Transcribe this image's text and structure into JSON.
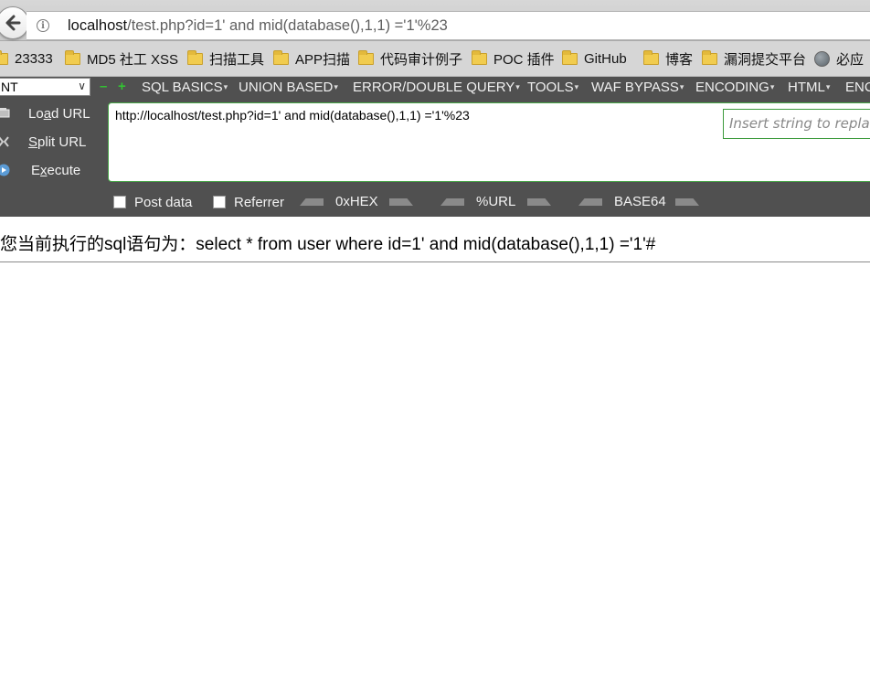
{
  "address_bar": {
    "url_host": "localhost",
    "url_rest": "/test.php?id=1' and mid(database(),1,1) ='1'%23"
  },
  "bookmarks": [
    {
      "label": "23333",
      "icon": "folder-icon"
    },
    {
      "label": "MD5 社工 XSS",
      "icon": "folder-icon"
    },
    {
      "label": "扫描工具",
      "icon": "folder-icon"
    },
    {
      "label": "APP扫描",
      "icon": "folder-icon"
    },
    {
      "label": "代码审计例子",
      "icon": "folder-icon"
    },
    {
      "label": "POC 插件",
      "icon": "folder-icon"
    },
    {
      "label": "GitHub",
      "icon": "folder-icon"
    },
    {
      "label": "博客",
      "icon": "folder-icon"
    },
    {
      "label": "漏洞提交平台",
      "icon": "folder-icon"
    },
    {
      "label": "必应",
      "icon": "globe-icon"
    }
  ],
  "hackbar": {
    "select_value": "NT",
    "menus": [
      "SQL BASICS",
      "UNION BASED",
      "ERROR/DOUBLE QUERY",
      "TOOLS",
      "WAF BYPASS",
      "ENCODING",
      "HTML",
      "ENC"
    ],
    "buttons": {
      "load_url": "Load URL",
      "split_url": "Split URL",
      "execute": "Execute"
    },
    "url_value": "http://localhost/test.php?id=1' and mid(database(),1,1) ='1'%23",
    "checkboxes": {
      "post_data": "Post data",
      "referrer": "Referrer"
    },
    "encoders": [
      "0xHEX",
      "%URL",
      "BASE64"
    ],
    "replace_placeholder": "Insert string to replace"
  },
  "content": {
    "result_text": "您当前执行的sql语句为：select * from user where id=1' and mid(database(),1,1) ='1'#"
  },
  "colors": {
    "hackbar_bg": "#505050",
    "accent_green": "#33c233",
    "folder": "#f1cc4f"
  }
}
